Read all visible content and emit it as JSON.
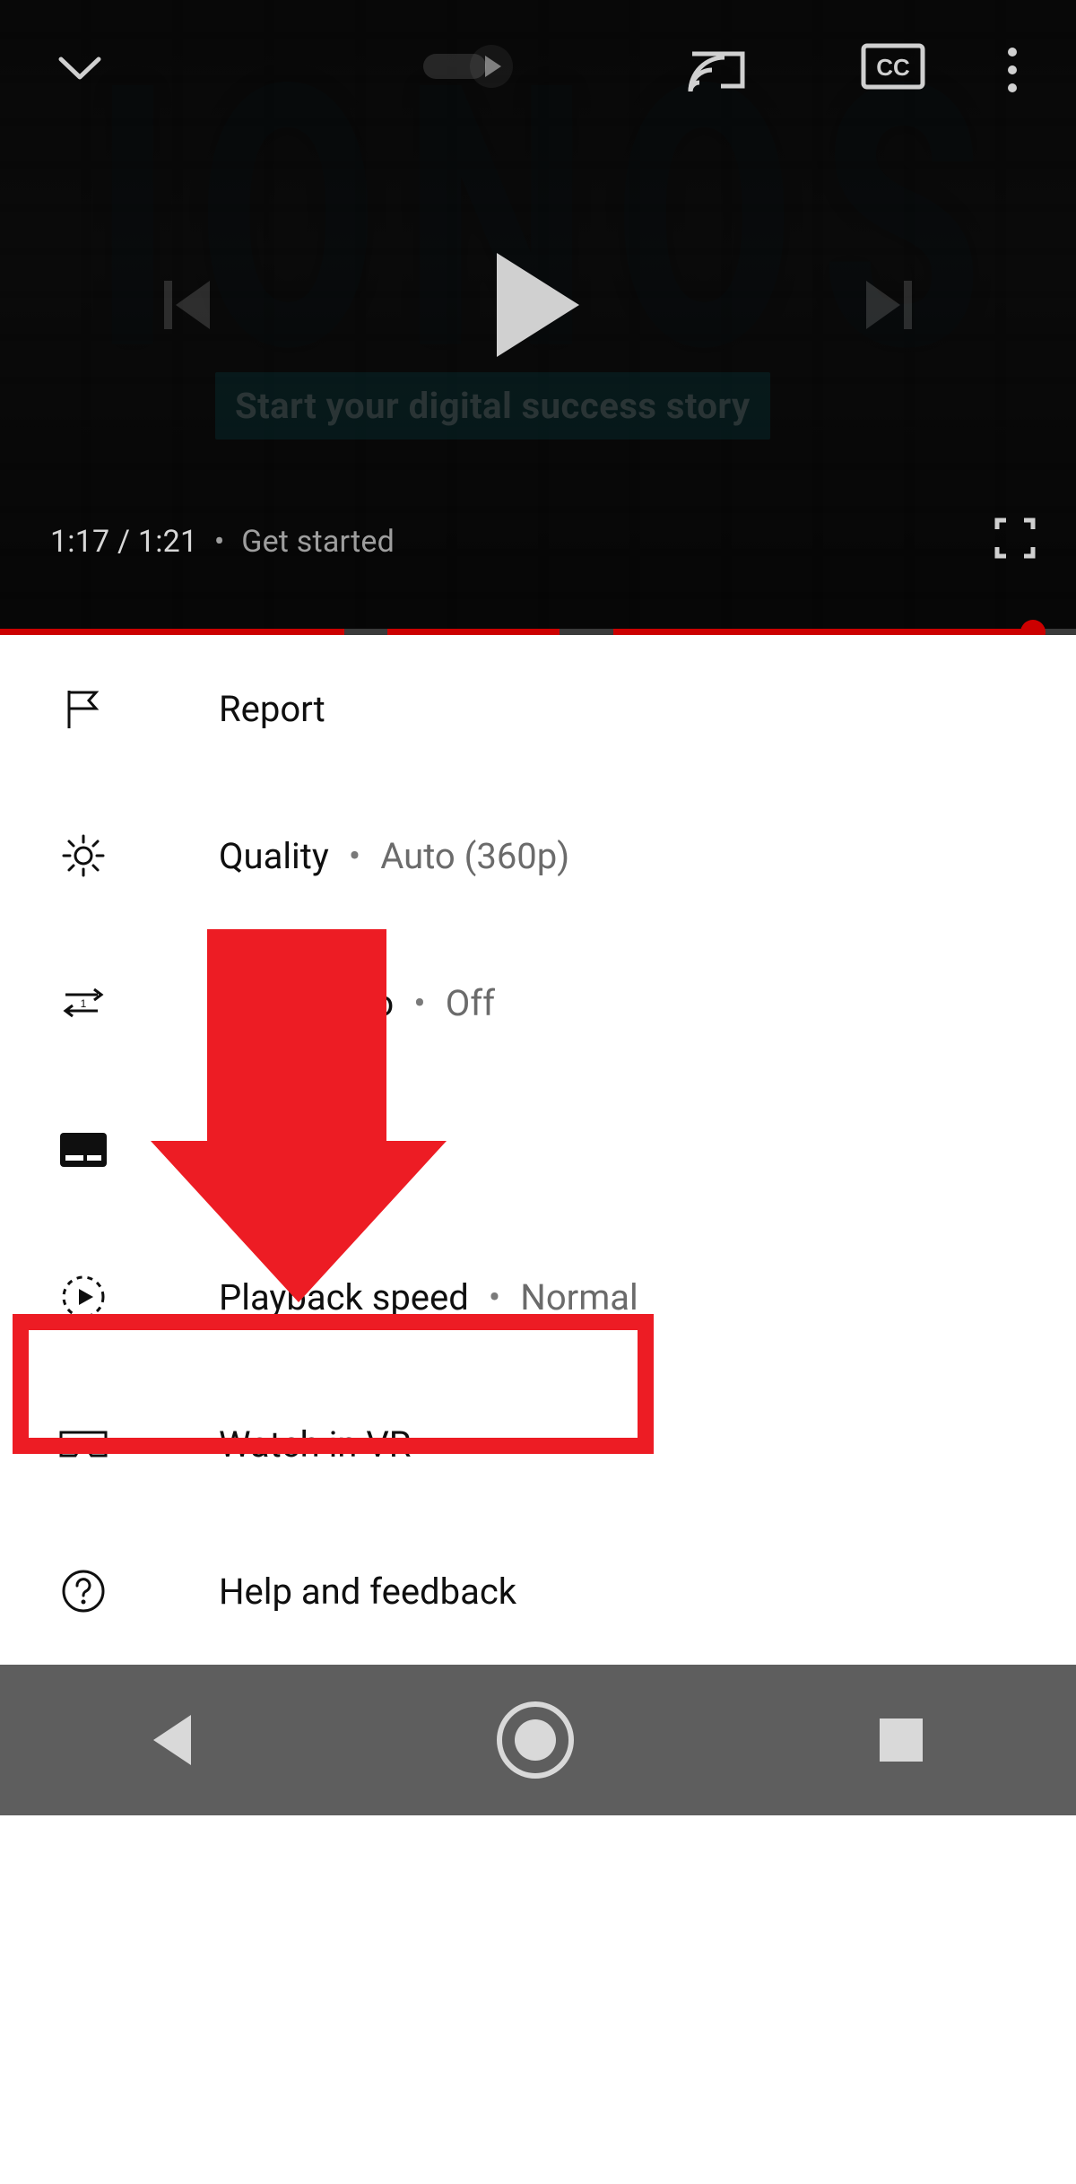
{
  "player": {
    "brand": {
      "logo_letters": "IONOS",
      "tagline": "Start your digital success story"
    },
    "status": {
      "current_time": "1:17",
      "duration": "1:21",
      "title_hint": "Get started"
    },
    "progress_pct": 96,
    "segments_pct": [
      {
        "s": 32,
        "w": 4
      },
      {
        "s": 52,
        "w": 5
      }
    ]
  },
  "menu": {
    "items": [
      {
        "key": "report",
        "label": "Report",
        "value": ""
      },
      {
        "key": "quality",
        "label": "Quality",
        "value": "Auto (360p)"
      },
      {
        "key": "loop",
        "label": "Loop video",
        "value": "Off"
      },
      {
        "key": "captions",
        "label": "Captions",
        "value": ""
      },
      {
        "key": "speed",
        "label": "Playback speed",
        "value": "Normal"
      },
      {
        "key": "vr",
        "label": "Watch in VR",
        "value": ""
      },
      {
        "key": "help",
        "label": "Help and feedback",
        "value": ""
      }
    ]
  },
  "annotation": {
    "highlight_target": "loop"
  },
  "colors": {
    "accent_red": "#cc0000",
    "annotation_red": "#ED1C24",
    "menu_text": "#0f0f0f",
    "menu_secondary": "#6b6b6b"
  }
}
